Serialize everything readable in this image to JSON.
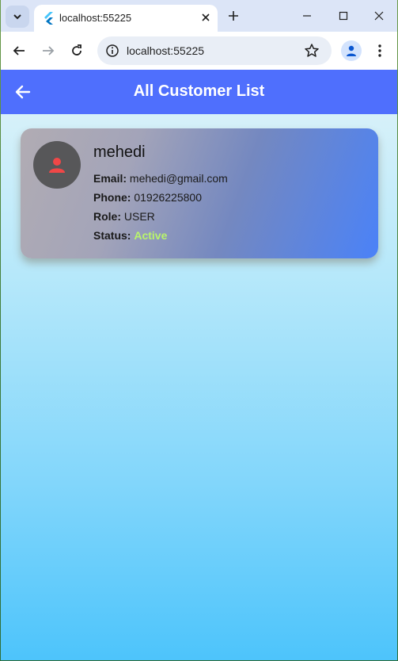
{
  "browser": {
    "tab_title": "localhost:55225",
    "url": "localhost:55225"
  },
  "app": {
    "title": "All Customer List",
    "accent_color": "#4f6ffd"
  },
  "customers": [
    {
      "name": "mehedi",
      "email_label": "Email:",
      "email": "mehedi@gmail.com",
      "phone_label": "Phone:",
      "phone": "01926225800",
      "role_label": "Role:",
      "role": "USER",
      "status_label": "Status:",
      "status": "Active",
      "avatar_icon": "person-icon",
      "status_color": "#b9f56b"
    }
  ]
}
